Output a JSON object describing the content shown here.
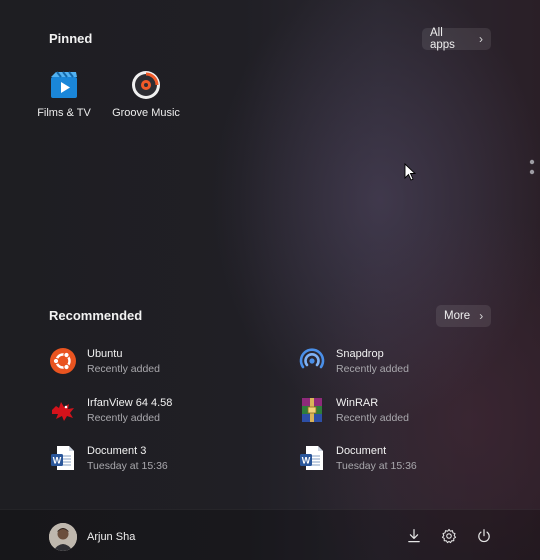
{
  "pinned": {
    "title": "Pinned",
    "all_apps_label": "All apps",
    "apps": [
      {
        "label": "Films & TV",
        "icon": "films-tv-icon"
      },
      {
        "label": "Groove Music",
        "icon": "groove-music-icon"
      }
    ]
  },
  "recommended": {
    "title": "Recommended",
    "more_label": "More",
    "items": [
      {
        "name": "Ubuntu",
        "sub": "Recently added",
        "icon": "ubuntu-icon"
      },
      {
        "name": "Snapdrop",
        "sub": "Recently added",
        "icon": "snapdrop-icon"
      },
      {
        "name": "IrfanView 64 4.58",
        "sub": "Recently added",
        "icon": "irfanview-icon"
      },
      {
        "name": "WinRAR",
        "sub": "Recently added",
        "icon": "winrar-icon"
      },
      {
        "name": "Document 3",
        "sub": "Tuesday at 15:36",
        "icon": "word-document-icon"
      },
      {
        "name": "Document",
        "sub": "Tuesday at 15:36",
        "icon": "word-document-icon"
      }
    ]
  },
  "footer": {
    "user_name": "Arjun Sha",
    "icons": [
      "download-icon",
      "settings-icon",
      "power-icon"
    ]
  },
  "colors": {
    "films_blue": "#1a86d8",
    "ubuntu_orange": "#e95420",
    "word_blue": "#2b579a",
    "snapdrop_blue": "#4a8fe8"
  }
}
